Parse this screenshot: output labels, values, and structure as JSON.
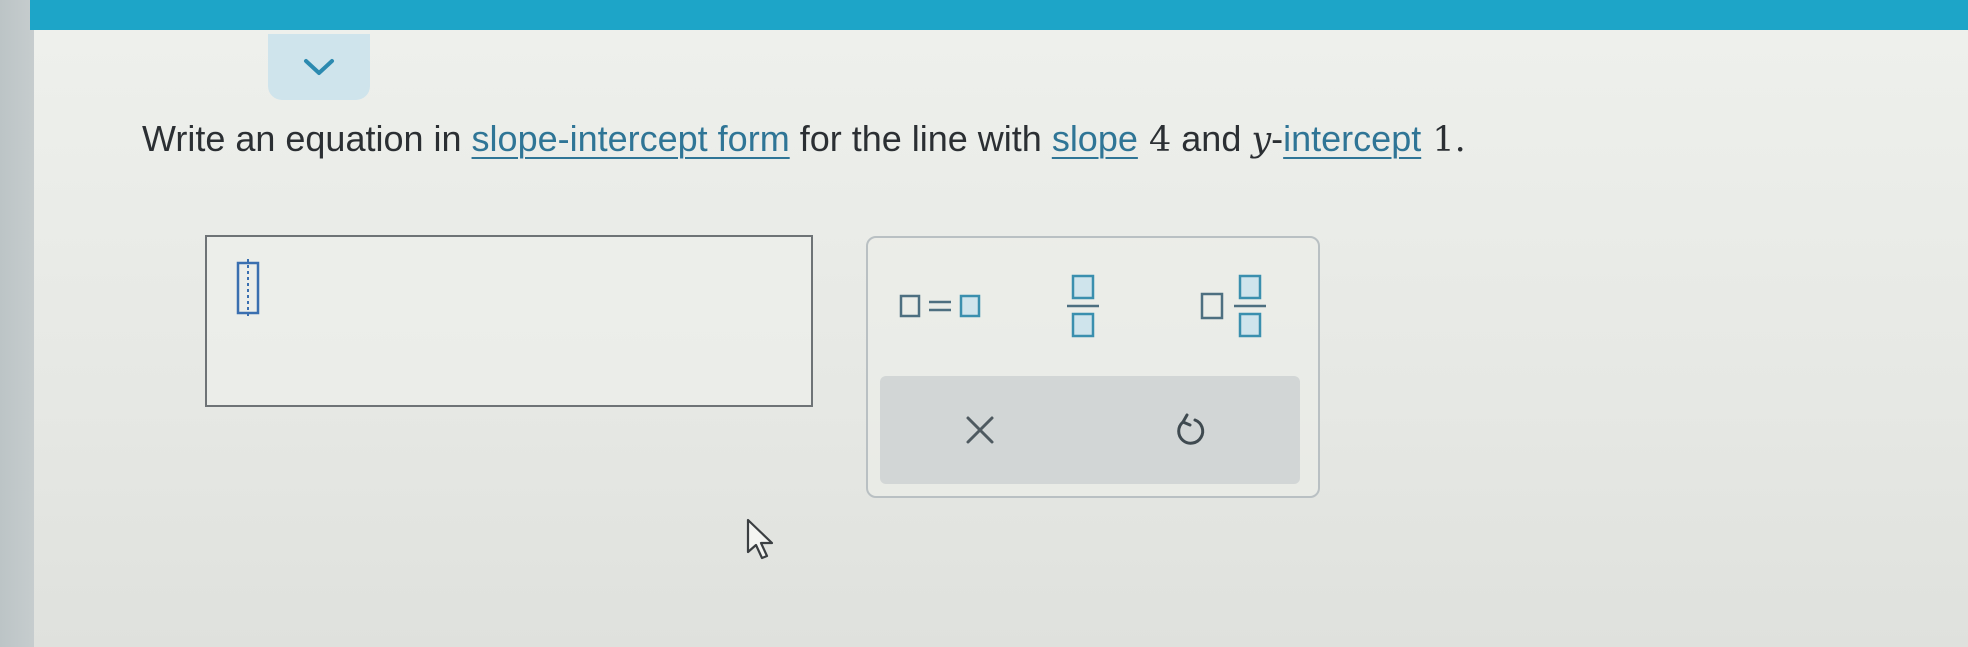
{
  "question": {
    "part1": "Write an equation in ",
    "link_slope_intercept_form": "slope-intercept form",
    "part2": " for the line with ",
    "link_slope": "slope",
    "slope_value": " 4",
    "part3": " and ",
    "y_var": "y",
    "dash": "-",
    "link_intercept": "intercept",
    "intercept_value": " 1",
    "period": "."
  },
  "answer": {
    "value": ""
  },
  "toolbar": {
    "equals_template": "□=□",
    "fraction_template": "□/□",
    "mixed_number_template": "□ □/□",
    "clear_label": "×",
    "undo_icon": "undo-icon"
  },
  "colors": {
    "top_bar": "#1da5c8",
    "link": "#2f7596",
    "tab": "#cfe4ec",
    "tool_accent": "#3a8fae"
  }
}
